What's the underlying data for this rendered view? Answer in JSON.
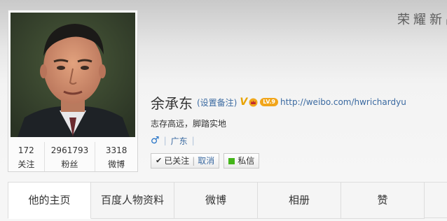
{
  "banner": {
    "text": "荣耀新品"
  },
  "profile": {
    "name": "余承东",
    "remark_label": "(设置备注)",
    "verified_badge": "V",
    "level_badge": "LV.9",
    "url": "http://weibo.com/hwrichardyu",
    "bio": "志存高远，脚踏实地",
    "gender_icon": "♂",
    "location": "广东",
    "separator": "|"
  },
  "stats": [
    {
      "value": "172",
      "label": "关注"
    },
    {
      "value": "2961793",
      "label": "粉丝"
    },
    {
      "value": "3318",
      "label": "微博"
    }
  ],
  "actions": {
    "followed_label": "已关注",
    "cancel_separator": "|",
    "cancel_label": "取消",
    "message_label": "私信"
  },
  "tabs": [
    {
      "label": "他的主页",
      "active": true
    },
    {
      "label": "百度人物资料",
      "active": false
    },
    {
      "label": "微博",
      "active": false
    },
    {
      "label": "相册",
      "active": false
    },
    {
      "label": "赞",
      "active": false
    }
  ],
  "colors": {
    "link": "#3b6aa1",
    "verified": "#e8a300",
    "message_icon": "#44b51a",
    "gender": "#1f6fc5"
  }
}
